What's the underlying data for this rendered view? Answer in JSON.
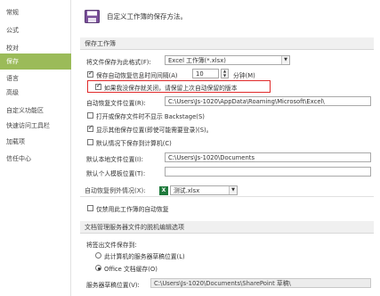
{
  "sidebar": {
    "items": [
      {
        "label": "常规",
        "active": false
      },
      {
        "label": "公式",
        "active": false
      },
      {
        "label": "校对",
        "active": false
      },
      {
        "label": "保存",
        "active": true
      },
      {
        "label": "语言",
        "active": false
      },
      {
        "label": "高级",
        "active": false
      },
      {
        "label": "自定义功能区",
        "active": false
      },
      {
        "label": "快速访问工具栏",
        "active": false
      },
      {
        "label": "加载项",
        "active": false
      },
      {
        "label": "信任中心",
        "active": false
      }
    ]
  },
  "header": {
    "title": "自定义工作簿的保存方法。"
  },
  "save_workbooks": {
    "section_title": "保存工作簿",
    "format_label": "将文件保存为此格式(F):",
    "format_value": "Excel 工作簿(*.xlsx)",
    "autorecover_label": "保存自动恢复信息时间间隔(A)",
    "autorecover_checked": true,
    "autorecover_minutes": "10",
    "minutes_label": "分钟(M)",
    "keep_last_label": "如果我没保存就关闭，请保留上次自动保留的版本",
    "keep_last_checked": true,
    "autorecover_location_label": "自动恢复文件位置(R):",
    "autorecover_location_value": "C:\\Users\\Js-1020\\AppData\\Roaming\\Microsoft\\Excel\\",
    "no_backstage_label": "打开或保存文件时不显示 Backstage(S)",
    "no_backstage_checked": false,
    "show_more_locations_label": "显示其他保存位置(即使可能需要登录)(S)。",
    "show_more_locations_checked": true,
    "save_to_computer_label": "默认情况下保存到计算机(C)",
    "save_to_computer_checked": false,
    "local_location_label": "默认本地文件位置(I):",
    "local_location_value": "C:\\Users\\Js-1020\\Documents",
    "personal_templates_label": "默认个人模板位置(T):",
    "personal_templates_value": ""
  },
  "autorecover_exceptions": {
    "label": "自动恢复例外情况(X):",
    "file_value": "测试.xlsx",
    "disable_label": "仅禁用此工作簿的自动恢复",
    "disable_checked": false
  },
  "offline_editing": {
    "section_title": "文档管理服务器文件的脱机编辑选项",
    "save_checked_out_label": "将签出文件保存到:",
    "option_server_drafts": "此计算机的服务器草稿位置(L)",
    "option_server_drafts_checked": false,
    "option_office_cache": "Office 文档缓存(O)",
    "option_office_cache_checked": true,
    "drafts_location_label": "服务器草稿位置(V):",
    "drafts_location_value": "C:\\Users\\Js-1020\\Documents\\SharePoint 草稿\\"
  },
  "icons": {
    "header": "floppy-disk-icon",
    "excel_file": "excel-file-icon",
    "dropdown": "chevron-down-icon"
  },
  "colors": {
    "active_nav": "#9bbb59",
    "highlight_border": "#e02b2b",
    "section_bg": "#f0f0f0"
  }
}
